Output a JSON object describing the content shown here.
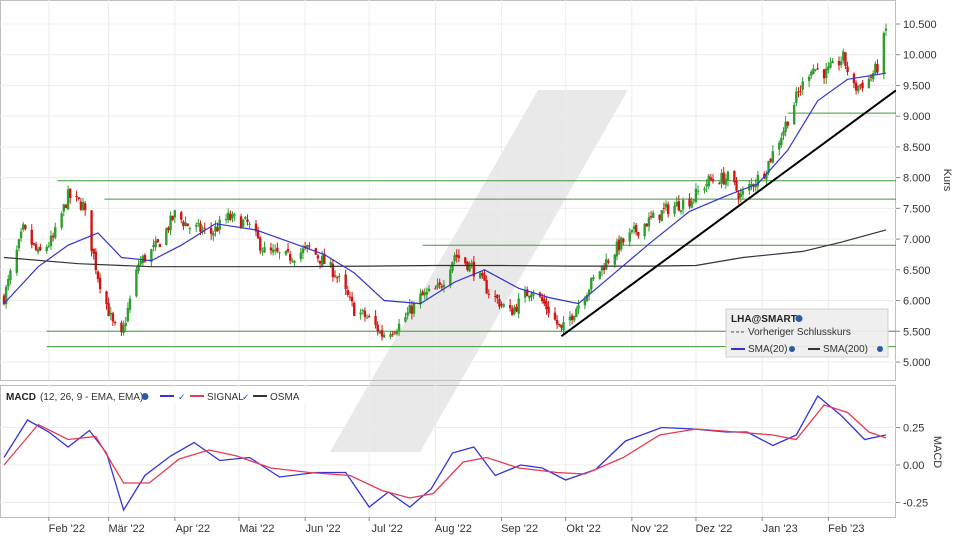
{
  "chart_data": [
    {
      "type": "candlestick",
      "instrument": "LHA@SMART",
      "ylabel": "Kurs",
      "ylim": [
        4.75,
        10.65
      ],
      "yticks": [
        5.0,
        5.5,
        6.0,
        6.5,
        7.0,
        7.5,
        8.0,
        8.5,
        9.0,
        9.5,
        10.0,
        10.5
      ],
      "ytick_labels": [
        "5.000",
        "5.500",
        "6.000",
        "6.500",
        "7.000",
        "7.500",
        "8.000",
        "8.500",
        "9.000",
        "9.500",
        "10.000",
        "10.500"
      ],
      "x_months": [
        "Feb '22",
        "Mär '22",
        "Apr '22",
        "Mai '22",
        "Jun '22",
        "Jul '22",
        "Aug '22",
        "Sep '22",
        "Okt '22",
        "Nov '22",
        "Dez '22",
        "Jan '23",
        "Feb '23"
      ],
      "x_range": [
        "2022-01-11",
        "2023-02-28"
      ],
      "price_path": [
        {
          "x": "2022-01-11",
          "y": 6.05
        },
        {
          "x": "2022-01-20",
          "y": 7.15
        },
        {
          "x": "2022-01-27",
          "y": 6.75
        },
        {
          "x": "2022-02-03",
          "y": 7.0
        },
        {
          "x": "2022-02-10",
          "y": 7.7
        },
        {
          "x": "2022-02-17",
          "y": 7.55
        },
        {
          "x": "2022-02-24",
          "y": 6.4
        },
        {
          "x": "2022-03-03",
          "y": 5.6
        },
        {
          "x": "2022-03-07",
          "y": 5.4
        },
        {
          "x": "2022-03-15",
          "y": 6.6
        },
        {
          "x": "2022-03-24",
          "y": 6.9
        },
        {
          "x": "2022-04-01",
          "y": 7.4
        },
        {
          "x": "2022-04-08",
          "y": 7.2
        },
        {
          "x": "2022-04-18",
          "y": 7.1
        },
        {
          "x": "2022-04-26",
          "y": 7.35
        },
        {
          "x": "2022-05-05",
          "y": 7.25
        },
        {
          "x": "2022-05-13",
          "y": 6.8
        },
        {
          "x": "2022-05-24",
          "y": 6.7
        },
        {
          "x": "2022-06-03",
          "y": 6.85
        },
        {
          "x": "2022-06-15",
          "y": 6.45
        },
        {
          "x": "2022-06-24",
          "y": 5.85
        },
        {
          "x": "2022-07-01",
          "y": 5.7
        },
        {
          "x": "2022-07-07",
          "y": 5.45
        },
        {
          "x": "2022-07-15",
          "y": 5.6
        },
        {
          "x": "2022-07-25",
          "y": 6.05
        },
        {
          "x": "2022-08-03",
          "y": 6.2
        },
        {
          "x": "2022-08-10",
          "y": 6.75
        },
        {
          "x": "2022-08-18",
          "y": 6.55
        },
        {
          "x": "2022-08-26",
          "y": 6.15
        },
        {
          "x": "2022-09-05",
          "y": 5.8
        },
        {
          "x": "2022-09-15",
          "y": 6.2
        },
        {
          "x": "2022-09-23",
          "y": 5.85
        },
        {
          "x": "2022-09-29",
          "y": 5.5
        },
        {
          "x": "2022-10-07",
          "y": 5.95
        },
        {
          "x": "2022-10-17",
          "y": 6.5
        },
        {
          "x": "2022-10-26",
          "y": 6.9
        },
        {
          "x": "2022-11-07",
          "y": 7.25
        },
        {
          "x": "2022-11-18",
          "y": 7.5
        },
        {
          "x": "2022-11-29",
          "y": 7.65
        },
        {
          "x": "2022-12-07",
          "y": 7.95
        },
        {
          "x": "2022-12-16",
          "y": 8.0
        },
        {
          "x": "2022-12-22",
          "y": 7.7
        },
        {
          "x": "2023-01-02",
          "y": 8.1
        },
        {
          "x": "2023-01-10",
          "y": 8.7
        },
        {
          "x": "2023-01-17",
          "y": 9.3
        },
        {
          "x": "2023-01-24",
          "y": 9.8
        },
        {
          "x": "2023-01-31",
          "y": 9.7
        },
        {
          "x": "2023-02-08",
          "y": 9.95
        },
        {
          "x": "2023-02-13",
          "y": 9.45
        },
        {
          "x": "2023-02-20",
          "y": 9.6
        },
        {
          "x": "2023-02-24",
          "y": 9.8
        },
        {
          "x": "2023-02-28",
          "y": 10.4
        }
      ],
      "sma20_path": [
        {
          "x": "2022-01-11",
          "y": 5.95
        },
        {
          "x": "2022-01-27",
          "y": 6.55
        },
        {
          "x": "2022-02-10",
          "y": 6.9
        },
        {
          "x": "2022-02-24",
          "y": 7.1
        },
        {
          "x": "2022-03-07",
          "y": 6.7
        },
        {
          "x": "2022-03-21",
          "y": 6.65
        },
        {
          "x": "2022-04-04",
          "y": 6.9
        },
        {
          "x": "2022-04-20",
          "y": 7.25
        },
        {
          "x": "2022-05-09",
          "y": 7.15
        },
        {
          "x": "2022-05-25",
          "y": 6.95
        },
        {
          "x": "2022-06-10",
          "y": 6.75
        },
        {
          "x": "2022-06-24",
          "y": 6.45
        },
        {
          "x": "2022-07-08",
          "y": 6.0
        },
        {
          "x": "2022-07-25",
          "y": 5.95
        },
        {
          "x": "2022-08-10",
          "y": 6.3
        },
        {
          "x": "2022-08-24",
          "y": 6.5
        },
        {
          "x": "2022-09-09",
          "y": 6.2
        },
        {
          "x": "2022-09-23",
          "y": 6.05
        },
        {
          "x": "2022-10-07",
          "y": 5.95
        },
        {
          "x": "2022-10-24",
          "y": 6.45
        },
        {
          "x": "2022-11-10",
          "y": 6.95
        },
        {
          "x": "2022-11-28",
          "y": 7.45
        },
        {
          "x": "2022-12-15",
          "y": 7.7
        },
        {
          "x": "2022-12-30",
          "y": 7.9
        },
        {
          "x": "2023-01-13",
          "y": 8.45
        },
        {
          "x": "2023-01-27",
          "y": 9.25
        },
        {
          "x": "2023-02-10",
          "y": 9.6
        },
        {
          "x": "2023-02-28",
          "y": 9.7
        }
      ],
      "sma200_path": [
        {
          "x": "2022-01-11",
          "y": 6.7
        },
        {
          "x": "2022-02-15",
          "y": 6.6
        },
        {
          "x": "2022-03-21",
          "y": 6.55
        },
        {
          "x": "2022-04-20",
          "y": 6.55
        },
        {
          "x": "2022-05-25",
          "y": 6.55
        },
        {
          "x": "2022-07-01",
          "y": 6.56
        },
        {
          "x": "2022-08-01",
          "y": 6.57
        },
        {
          "x": "2022-09-01",
          "y": 6.57
        },
        {
          "x": "2022-10-03",
          "y": 6.56
        },
        {
          "x": "2022-11-10",
          "y": 6.56
        },
        {
          "x": "2022-12-01",
          "y": 6.57
        },
        {
          "x": "2022-12-23",
          "y": 6.7
        },
        {
          "x": "2023-01-20",
          "y": 6.8
        },
        {
          "x": "2023-02-07",
          "y": 6.95
        },
        {
          "x": "2023-02-28",
          "y": 7.15
        }
      ],
      "horizontal_levels": [
        {
          "y": 9.05,
          "x0": "2023-01-13",
          "x1": "2023-02-28"
        },
        {
          "y": 7.95,
          "x0": "2022-02-05",
          "x1": "2023-02-28"
        },
        {
          "y": 7.65,
          "x0": "2022-02-27",
          "x1": "2023-02-28"
        },
        {
          "y": 6.9,
          "x0": "2022-07-26",
          "x1": "2023-02-28"
        },
        {
          "y": 5.5,
          "x0": "2022-01-31",
          "x1": "2023-02-28"
        },
        {
          "y": 5.25,
          "x0": "2022-01-31",
          "x1": "2023-02-28"
        }
      ],
      "trendline": {
        "x0": "2022-09-29",
        "y0": 5.42,
        "x1": "2023-02-28",
        "y1": 9.42
      },
      "legend": {
        "title": "LHA@SMART",
        "items": [
          {
            "label": "Vorheriger Schlusskurs",
            "color": "#555555"
          },
          {
            "label": "SMA(20)",
            "color": "#3333cc"
          },
          {
            "label": "SMA(200)",
            "color": "#333333"
          }
        ],
        "placement": "bottom-right"
      },
      "colors": {
        "up": "#2e9e2e",
        "down": "#d01515",
        "sma20": "#3333cc",
        "sma200": "#333333",
        "level": "#3a9a3a",
        "trend": "#000000"
      }
    },
    {
      "type": "line",
      "ylabel": "MACD",
      "legend_label": "MACD",
      "params": "(12, 26, 9 - EMA, EMA)",
      "ylim": [
        -0.31,
        0.43
      ],
      "yticks": [
        -0.25,
        0.0,
        0.25
      ],
      "ytick_labels": [
        "-0.25",
        "0.00",
        "0.25"
      ],
      "series": [
        {
          "name": "MACD",
          "color": "#3333dd",
          "points": [
            {
              "x": "2022-01-11",
              "y": 0.05
            },
            {
              "x": "2022-01-22",
              "y": 0.3
            },
            {
              "x": "2022-02-01",
              "y": 0.22
            },
            {
              "x": "2022-02-10",
              "y": 0.12
            },
            {
              "x": "2022-02-20",
              "y": 0.23
            },
            {
              "x": "2022-02-28",
              "y": 0.08
            },
            {
              "x": "2022-03-08",
              "y": -0.3
            },
            {
              "x": "2022-03-18",
              "y": -0.07
            },
            {
              "x": "2022-03-30",
              "y": 0.06
            },
            {
              "x": "2022-04-10",
              "y": 0.15
            },
            {
              "x": "2022-04-22",
              "y": 0.03
            },
            {
              "x": "2022-05-06",
              "y": 0.05
            },
            {
              "x": "2022-05-20",
              "y": -0.08
            },
            {
              "x": "2022-06-06",
              "y": -0.05
            },
            {
              "x": "2022-06-20",
              "y": -0.05
            },
            {
              "x": "2022-07-01",
              "y": -0.28
            },
            {
              "x": "2022-07-10",
              "y": -0.18
            },
            {
              "x": "2022-07-20",
              "y": -0.28
            },
            {
              "x": "2022-07-30",
              "y": -0.16
            },
            {
              "x": "2022-08-09",
              "y": 0.08
            },
            {
              "x": "2022-08-19",
              "y": 0.12
            },
            {
              "x": "2022-08-29",
              "y": -0.07
            },
            {
              "x": "2022-09-10",
              "y": 0.0
            },
            {
              "x": "2022-09-20",
              "y": -0.02
            },
            {
              "x": "2022-10-01",
              "y": -0.1
            },
            {
              "x": "2022-10-15",
              "y": -0.03
            },
            {
              "x": "2022-10-29",
              "y": 0.16
            },
            {
              "x": "2022-11-15",
              "y": 0.25
            },
            {
              "x": "2022-11-30",
              "y": 0.24
            },
            {
              "x": "2022-12-15",
              "y": 0.22
            },
            {
              "x": "2022-12-25",
              "y": 0.22
            },
            {
              "x": "2023-01-06",
              "y": 0.13
            },
            {
              "x": "2023-01-17",
              "y": 0.2
            },
            {
              "x": "2023-01-27",
              "y": 0.46
            },
            {
              "x": "2023-02-07",
              "y": 0.33
            },
            {
              "x": "2023-02-18",
              "y": 0.17
            },
            {
              "x": "2023-02-28",
              "y": 0.2
            }
          ]
        },
        {
          "name": "SIGNAL",
          "color": "#e63a55",
          "points": [
            {
              "x": "2022-01-11",
              "y": 0.0
            },
            {
              "x": "2022-01-27",
              "y": 0.27
            },
            {
              "x": "2022-02-10",
              "y": 0.17
            },
            {
              "x": "2022-02-23",
              "y": 0.19
            },
            {
              "x": "2022-03-08",
              "y": -0.12
            },
            {
              "x": "2022-03-20",
              "y": -0.12
            },
            {
              "x": "2022-04-03",
              "y": 0.04
            },
            {
              "x": "2022-04-17",
              "y": 0.1
            },
            {
              "x": "2022-04-30",
              "y": 0.06
            },
            {
              "x": "2022-05-16",
              "y": -0.02
            },
            {
              "x": "2022-06-03",
              "y": -0.05
            },
            {
              "x": "2022-06-22",
              "y": -0.07
            },
            {
              "x": "2022-07-07",
              "y": -0.17
            },
            {
              "x": "2022-07-20",
              "y": -0.22
            },
            {
              "x": "2022-07-31",
              "y": -0.19
            },
            {
              "x": "2022-08-14",
              "y": 0.02
            },
            {
              "x": "2022-08-25",
              "y": 0.05
            },
            {
              "x": "2022-09-09",
              "y": -0.02
            },
            {
              "x": "2022-09-27",
              "y": -0.05
            },
            {
              "x": "2022-10-10",
              "y": -0.06
            },
            {
              "x": "2022-10-28",
              "y": 0.05
            },
            {
              "x": "2022-11-14",
              "y": 0.2
            },
            {
              "x": "2022-12-01",
              "y": 0.24
            },
            {
              "x": "2022-12-20",
              "y": 0.22
            },
            {
              "x": "2023-01-06",
              "y": 0.2
            },
            {
              "x": "2023-01-17",
              "y": 0.17
            },
            {
              "x": "2023-01-30",
              "y": 0.4
            },
            {
              "x": "2023-02-10",
              "y": 0.35
            },
            {
              "x": "2023-02-20",
              "y": 0.22
            },
            {
              "x": "2023-02-28",
              "y": 0.18
            }
          ]
        },
        {
          "name": "OSMA",
          "color": "#333333"
        }
      ]
    }
  ]
}
